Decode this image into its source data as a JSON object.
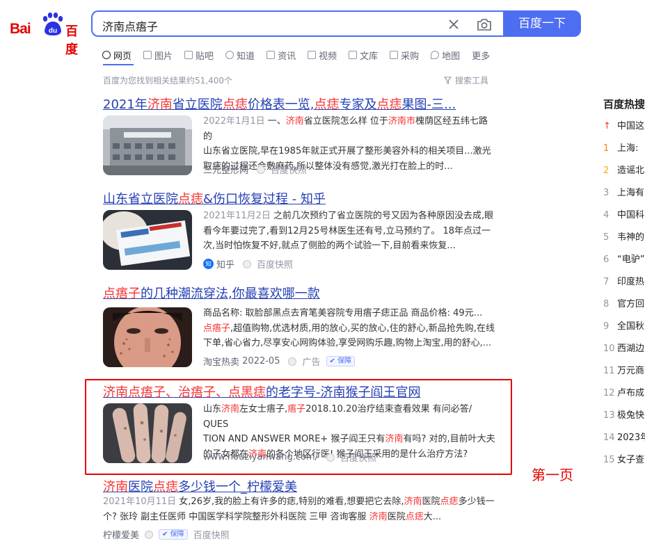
{
  "logo": {
    "bai": "Bai",
    "du": "百度",
    "paw_text": "du"
  },
  "search": {
    "query": "济南点痦子",
    "button": "百度一下"
  },
  "tabs": [
    "网页",
    "图片",
    "贴吧",
    "知道",
    "资讯",
    "视频",
    "文库",
    "采购",
    "地图",
    "更多"
  ],
  "result_count": "百度为您找到相关结果约51,400个",
  "tools_label": "搜索工具",
  "results": [
    {
      "title_parts": [
        "2021年",
        "济南",
        "省立医院",
        "点痣",
        "价格表一览,",
        "点痣",
        "专家及",
        "点痣",
        "果图-三..."
      ],
      "desc_lines": [
        [
          "2022年1月1日",
          " 一、",
          "济南",
          "省立医院怎么样 位于",
          "济南",
          "市",
          "槐荫区经五纬七路的"
        ],
        [
          "山东省立医院,早在1985年就正式开展了整形美容外科的相关项目...激光"
        ],
        [
          "取痣的过程还会敷麻药,所以整体没有感觉,激光打在脸上的时..."
        ]
      ],
      "source": "三元整形网",
      "snapshot": "百度快照"
    },
    {
      "title_parts": [
        "山东省立医院",
        "点痣",
        "&伤口恢复过程 - 知乎"
      ],
      "desc_lines": [
        [
          "2021年11月2日",
          " 之前几次预约了省立医院的号又因为各种原因没去成,眼"
        ],
        [
          "看今年要过完了,看到12月25号林医生还有号,立马预约了。 18年点过一"
        ],
        [
          "次,当时怕恢复不好,就点了侧脸的两个试验一下,目前看来恢复..."
        ]
      ],
      "source": "知乎",
      "snapshot": "百度快照"
    },
    {
      "title_parts": [
        "点痦子",
        "的几种潮流穿法,你最喜欢哪一款"
      ],
      "desc_lines": [
        [
          "商品名称: 取脸部黑点去宵笔美容院专用痦子痣正品    商品价格: 49元..."
        ],
        [
          "点痦子",
          ",超值购物,优选材质,用的放心,买的放心,住的舒心,新品抢先购,在线"
        ],
        [
          "下单,省心省力,尽享安心网购体验,享受网购乐趣,购物上淘宝,用的舒心,..."
        ]
      ],
      "source": "淘宝热卖",
      "source_date": "2022-05",
      "ad": "广告",
      "badge": "保障"
    },
    {
      "title_parts": [
        "济南点痦子、治痦子、点黑痣",
        "的老字号-济南猴子阎王官网"
      ],
      "desc_lines": [
        [
          "山东",
          "济南",
          "左女士痦子,",
          "痦子",
          "2018.10.20治疗结束查看效果 有问必答/ QUES"
        ],
        [
          "TION AND ANSWER MORE+ 猴子阎王只有",
          "济南",
          "有吗? 对的,目前叶大夫"
        ],
        [
          "的子女都在",
          "济南",
          "的各个地区行医! 猴子阎王采用的是什么治疗方法?"
        ]
      ],
      "source": "www.houziyanwang.com/",
      "snapshot": "百度快照"
    },
    {
      "title_parts": [
        "济南",
        "医院",
        "点痣",
        "多少钱一个_柠檬爱美"
      ],
      "desc_lines": [
        [
          "2021年10月11日",
          " 女,26岁,我的脸上有许多的痣,特别的难看,想要把它去除,",
          "济南",
          "医院",
          "点痣",
          "多少钱一"
        ],
        [
          "个? 张玲 副主任医师 中国医学科学院整形外科医院 三甲 咨询客服 ",
          "济南",
          "医院",
          "点痣",
          "大..."
        ]
      ],
      "source": "柠檬爱美",
      "badge": "保障",
      "snapshot": "百度快照"
    }
  ],
  "hot": {
    "title": "百度热搜",
    "items": [
      {
        "n": "↑",
        "t": "中国这"
      },
      {
        "n": "1",
        "t": "上海:"
      },
      {
        "n": "2",
        "t": "造谣北"
      },
      {
        "n": "3",
        "t": "上海有"
      },
      {
        "n": "4",
        "t": "中国科"
      },
      {
        "n": "5",
        "t": "韦神的"
      },
      {
        "n": "6",
        "t": "“电驴”"
      },
      {
        "n": "7",
        "t": "印度热"
      },
      {
        "n": "8",
        "t": "官方回"
      },
      {
        "n": "9",
        "t": "全国秋"
      },
      {
        "n": "10",
        "t": "西湖边"
      },
      {
        "n": "11",
        "t": "万元商"
      },
      {
        "n": "12",
        "t": "卢布成"
      },
      {
        "n": "13",
        "t": "极兔快"
      },
      {
        "n": "14",
        "t": "2023年"
      },
      {
        "n": "15",
        "t": "女子查"
      }
    ]
  },
  "annotation": "第一页"
}
